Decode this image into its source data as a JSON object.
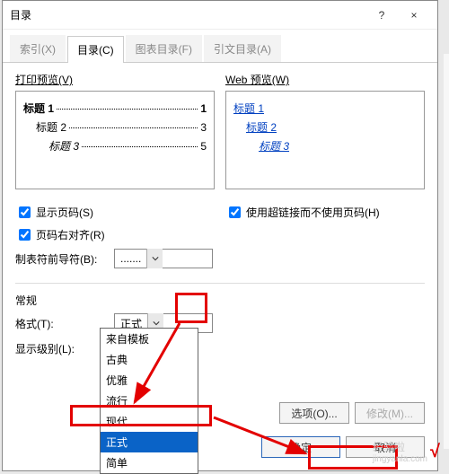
{
  "dialog": {
    "title": "目录",
    "help": "?",
    "close": "×"
  },
  "tabs": {
    "index": "索引(X)",
    "toc": "目录(C)",
    "fig": "图表目录(F)",
    "cite": "引文目录(A)"
  },
  "preview": {
    "print_label": "打印预览(V)",
    "web_label": "Web 预览(W)",
    "print": {
      "h1": "标题 1",
      "p1": "1",
      "h2": "标题 2",
      "p2": "3",
      "h3": "标题 3",
      "p3": "5"
    },
    "web": {
      "h1": "标题 1",
      "h2": "标题 2",
      "h3": "标题 3"
    }
  },
  "options": {
    "show_page": "显示页码(S)",
    "align_right": "页码右对齐(R)",
    "hyperlink": "使用超链接而不使用页码(H)",
    "leader_label": "制表符前导符(B):",
    "leader_value": "......."
  },
  "general": {
    "title": "常规",
    "format_label": "格式(T):",
    "format_value": "正式",
    "level_label": "显示级别(L):",
    "level_value": "",
    "dropdown": [
      "来自模板",
      "古典",
      "优雅",
      "流行",
      "现代",
      "正式",
      "简单"
    ]
  },
  "buttons": {
    "options": "选项(O)...",
    "modify": "修改(M)...",
    "ok": "确定",
    "cancel": "取消"
  },
  "watermark": {
    "brand": "经验啦",
    "url": "jingyanla.com"
  }
}
